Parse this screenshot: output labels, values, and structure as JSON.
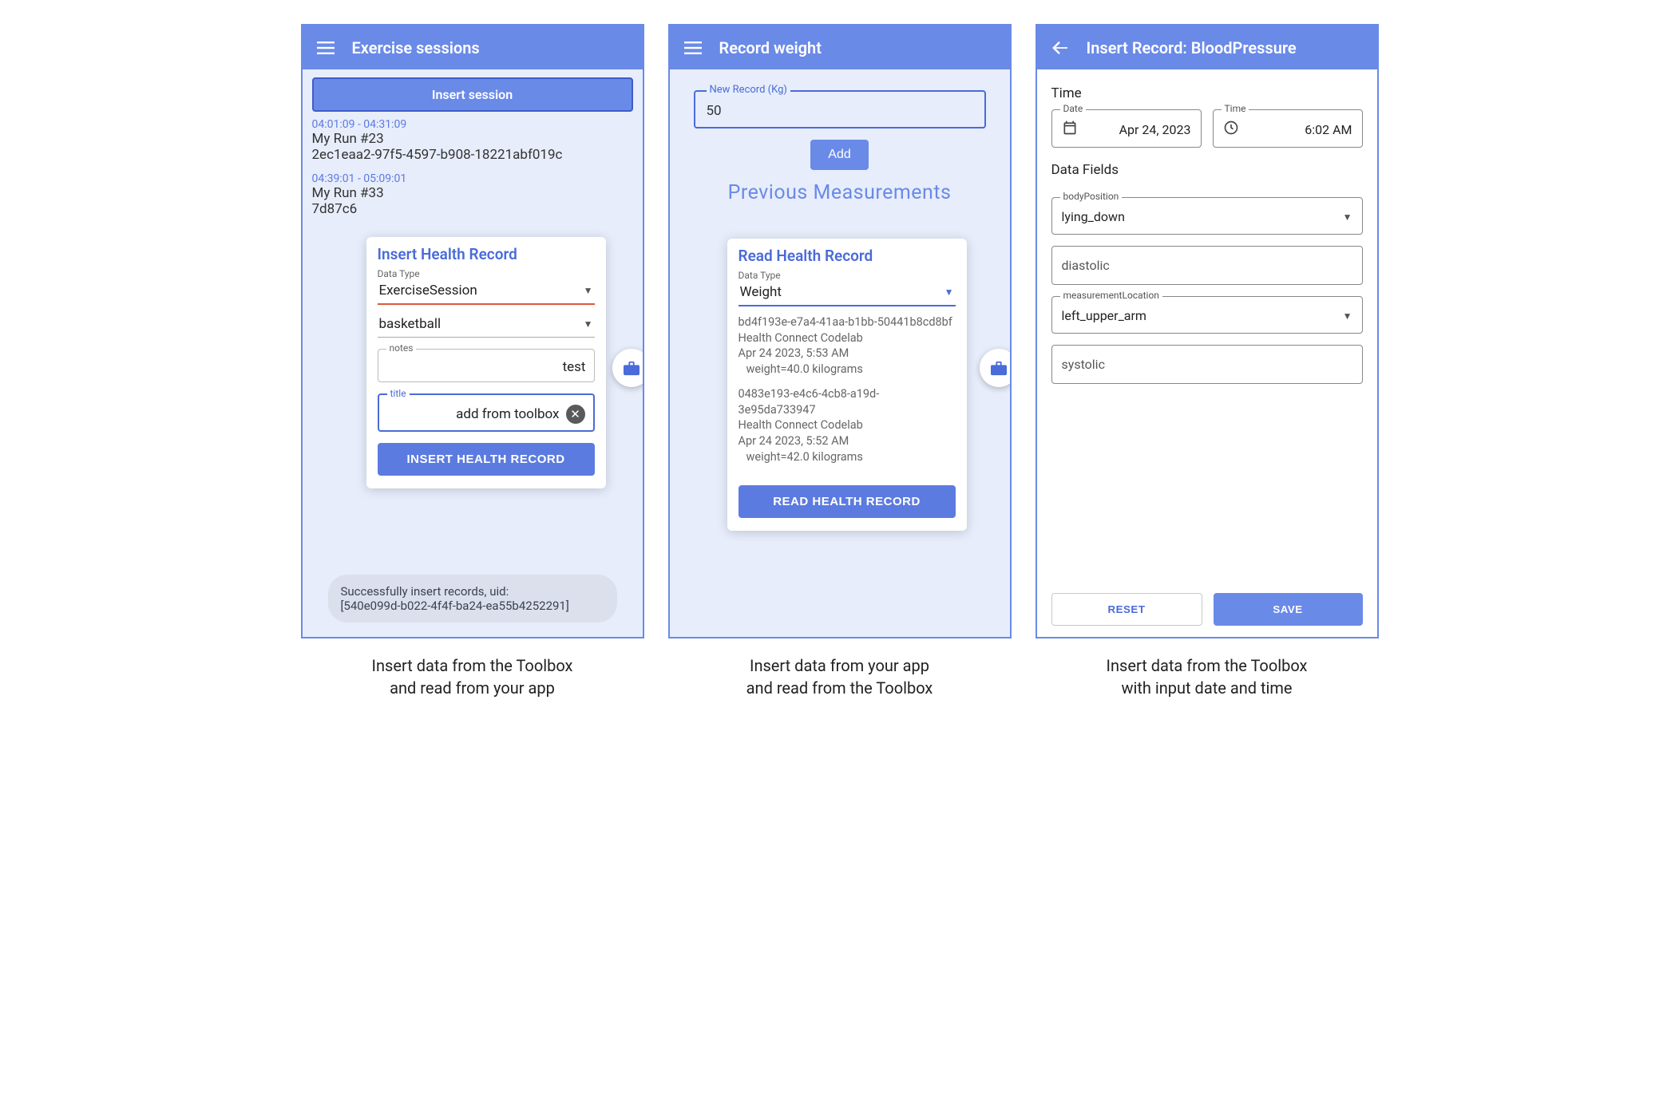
{
  "phone1": {
    "title": "Exercise sessions",
    "insertSession": "Insert session",
    "sessions": [
      {
        "time": "04:01:09 - 04:31:09",
        "title": "My Run #23",
        "uid": "2ec1eaa2-97f5-4597-b908-18221abf019c"
      },
      {
        "time": "04:39:01 - 05:09:01",
        "title": "My Run #33",
        "uid": "7d87c6"
      }
    ],
    "toastLine1": "Successfully insert records, uid:",
    "toastLine2": "[540e099d-b022-4f4f-ba24-ea55b4252291]",
    "card": {
      "title": "Insert Health Record",
      "dataTypeLabel": "Data Type",
      "dataTypeValue": "ExerciseSession",
      "exerciseValue": "basketball",
      "notesLabel": "notes",
      "notesValue": "test",
      "titleLabel": "title",
      "titleValue": "add from toolbox",
      "button": "INSERT HEALTH RECORD"
    }
  },
  "phone2": {
    "title": "Record weight",
    "recordLegend": "New Record (Kg)",
    "recordValue": "50",
    "addBtn": "Add",
    "prevHeader": "Previous Measurements",
    "card": {
      "title": "Read Health Record",
      "dataTypeLabel": "Data Type",
      "dataTypeValue": "Weight",
      "records": [
        {
          "id": "bd4f193e-e7a4-41aa-b1bb-50441b8cd8bf",
          "app": "Health Connect Codelab",
          "date": "Apr 24 2023, 5:53 AM",
          "weight": "weight=40.0 kilograms"
        },
        {
          "id": "0483e193-e4c6-4cb8-a19d-3e95da733947",
          "app": "Health Connect Codelab",
          "date": "Apr 24 2023, 5:52 AM",
          "weight": "weight=42.0 kilograms"
        }
      ],
      "button": "READ HEALTH RECORD"
    }
  },
  "phone3": {
    "title": "Insert Record: BloodPressure",
    "timeLabel": "Time",
    "dateLegend": "Date",
    "dateValue": "Apr 24, 2023",
    "timeLegend": "Time",
    "timeValue": "6:02 AM",
    "dataFieldsLabel": "Data Fields",
    "bodyPositionLegend": "bodyPosition",
    "bodyPositionValue": "lying_down",
    "diastolicLabel": "diastolic",
    "measurementLocationLegend": "measurementLocation",
    "measurementLocationValue": "left_upper_arm",
    "systolicLabel": "systolic",
    "resetBtn": "RESET",
    "saveBtn": "SAVE"
  },
  "captions": {
    "c1a": "Insert data from the Toolbox",
    "c1b": "and read from your app",
    "c2a": "Insert data from your app",
    "c2b": "and read from the Toolbox",
    "c3a": "Insert data from the Toolbox",
    "c3b": "with input date and time"
  }
}
